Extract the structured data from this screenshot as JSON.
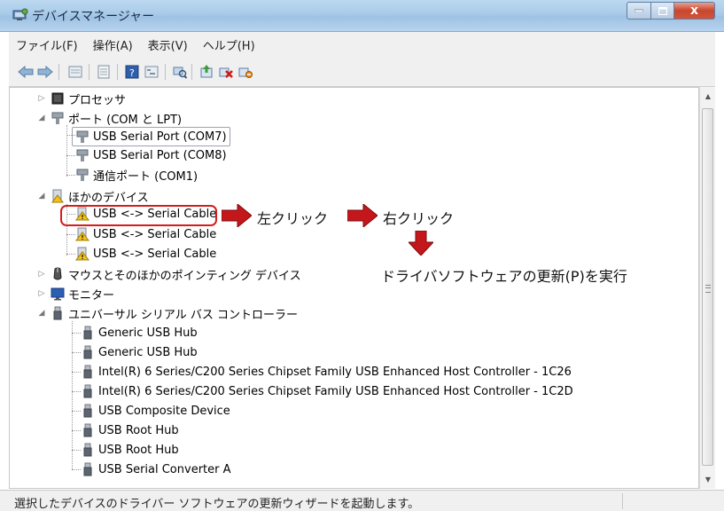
{
  "window": {
    "title": "デバイスマネージャー",
    "close_glyph": "x"
  },
  "menu": [
    {
      "label": "ファイル(F)"
    },
    {
      "label": "操作(A)"
    },
    {
      "label": "表示(V)"
    },
    {
      "label": "ヘルプ(H)"
    }
  ],
  "toolbar": {
    "icons": [
      "back-icon",
      "forward-icon",
      "properties-view-icon",
      "details-view-icon",
      "help-icon",
      "tree-view-icon",
      "scan-hardware-icon",
      "update-driver-icon",
      "uninstall-device-icon",
      "disable-device-icon"
    ]
  },
  "tree": {
    "nodes": [
      {
        "label": "プロセッサ",
        "icon": "processor-icon"
      },
      {
        "label": "ポート (COM と LPT)",
        "icon": "port-icon"
      },
      {
        "label": "USB Serial Port (COM7)",
        "icon": "port-icon"
      },
      {
        "label": "USB Serial Port (COM8)",
        "icon": "port-icon"
      },
      {
        "label": "通信ポート (COM1)",
        "icon": "port-icon"
      },
      {
        "label": "ほかのデバイス",
        "icon": "unknown-device-icon"
      },
      {
        "label": "USB <-> Serial Cable",
        "icon": "warning-device-icon"
      },
      {
        "label": "USB <-> Serial Cable",
        "icon": "warning-device-icon"
      },
      {
        "label": "USB <-> Serial Cable",
        "icon": "warning-device-icon"
      },
      {
        "label": "マウスとそのほかのポインティング デバイス",
        "icon": "mouse-icon"
      },
      {
        "label": "モニター",
        "icon": "monitor-icon"
      },
      {
        "label": "ユニバーサル シリアル バス コントローラー",
        "icon": "usb-plug-icon"
      },
      {
        "label": "Generic USB Hub",
        "icon": "usb-plug-icon"
      },
      {
        "label": "Generic USB Hub",
        "icon": "usb-plug-icon"
      },
      {
        "label": "Intel(R) 6 Series/C200 Series Chipset Family USB Enhanced Host Controller - 1C26",
        "icon": "usb-plug-icon"
      },
      {
        "label": "Intel(R) 6 Series/C200 Series Chipset Family USB Enhanced Host Controller - 1C2D",
        "icon": "usb-plug-icon"
      },
      {
        "label": "USB Composite Device",
        "icon": "usb-plug-icon"
      },
      {
        "label": "USB Root Hub",
        "icon": "usb-plug-icon"
      },
      {
        "label": "USB Root Hub",
        "icon": "usb-plug-icon"
      },
      {
        "label": "USB Serial Converter A",
        "icon": "usb-plug-icon"
      }
    ]
  },
  "annotations": {
    "step1": "左クリック",
    "step2": "右クリック",
    "step3": "ドライバソフトウェアの更新(P)を実行",
    "highlight_color": "#d21e1e",
    "arrow_color": "#c4171b"
  },
  "status": {
    "text": "選択したデバイスのドライバー ソフトウェアの更新ウィザードを起動します。"
  }
}
